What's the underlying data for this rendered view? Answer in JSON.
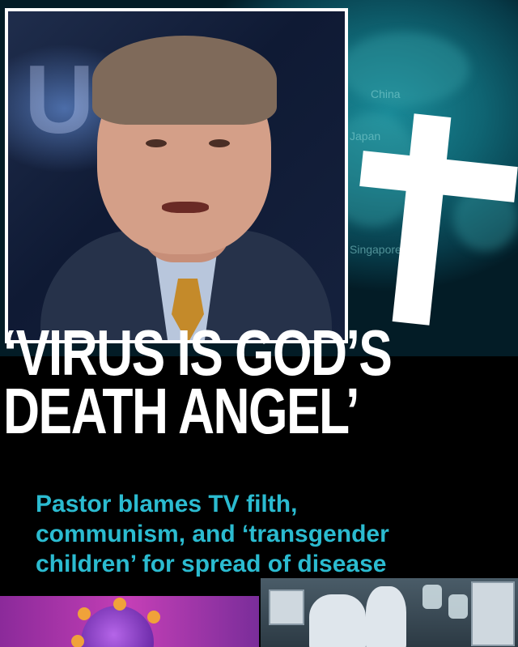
{
  "headline": {
    "line1": "‘VIRUS IS GOD’S",
    "line2": "DEATH ANGEL’"
  },
  "subhead": {
    "line1": "Pastor blames TV filth,",
    "line2": "communism, and ‘transgender",
    "line3": "children’ for spread of disease"
  },
  "map_labels": [
    "China",
    "Japan",
    "Singapore"
  ],
  "colors": {
    "subhead": "#2bbbd0",
    "headline": "#ffffff",
    "background": "#000000",
    "map_teal": "#0f6472"
  },
  "icons": [
    "cross-icon",
    "virus-icon"
  ]
}
